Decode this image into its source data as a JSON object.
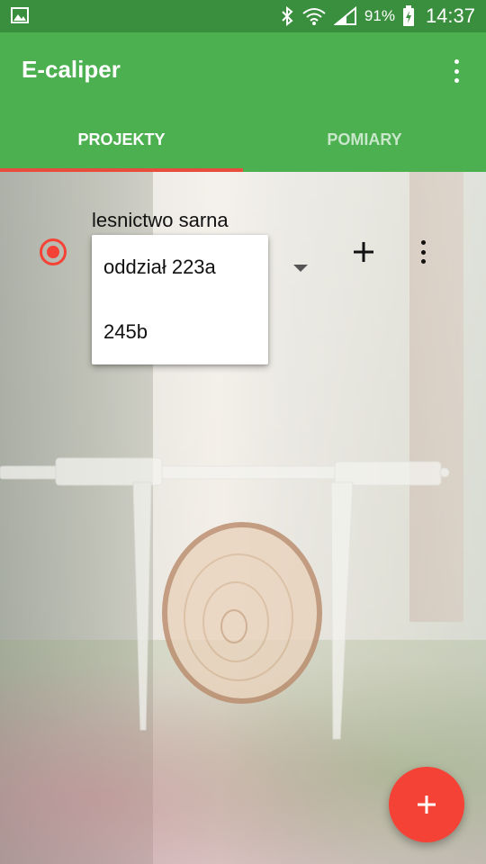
{
  "status_bar": {
    "battery_percent": "91%",
    "time": "14:37",
    "icons": [
      "gallery-icon",
      "bluetooth-icon",
      "wifi-icon",
      "signal-icon",
      "battery-charging-icon"
    ]
  },
  "app_bar": {
    "title": "E-caliper",
    "overflow_icon": "overflow-menu-icon"
  },
  "tabs": [
    {
      "label": "PROJEKTY",
      "active": true
    },
    {
      "label": "POMIARY",
      "active": false
    }
  ],
  "project": {
    "name": "lesnictwo sarna",
    "selected": true
  },
  "dropdown": {
    "options": [
      "oddział 223a",
      "245b"
    ]
  },
  "actions": {
    "add_icon": "plus-icon",
    "more_icon": "overflow-menu-icon"
  },
  "fab": {
    "icon": "plus-icon"
  },
  "colors": {
    "status_bar": "#3a8f3e",
    "app_bar": "#4caf50",
    "tab_indicator": "#e74c3c",
    "accent": "#f44336"
  }
}
